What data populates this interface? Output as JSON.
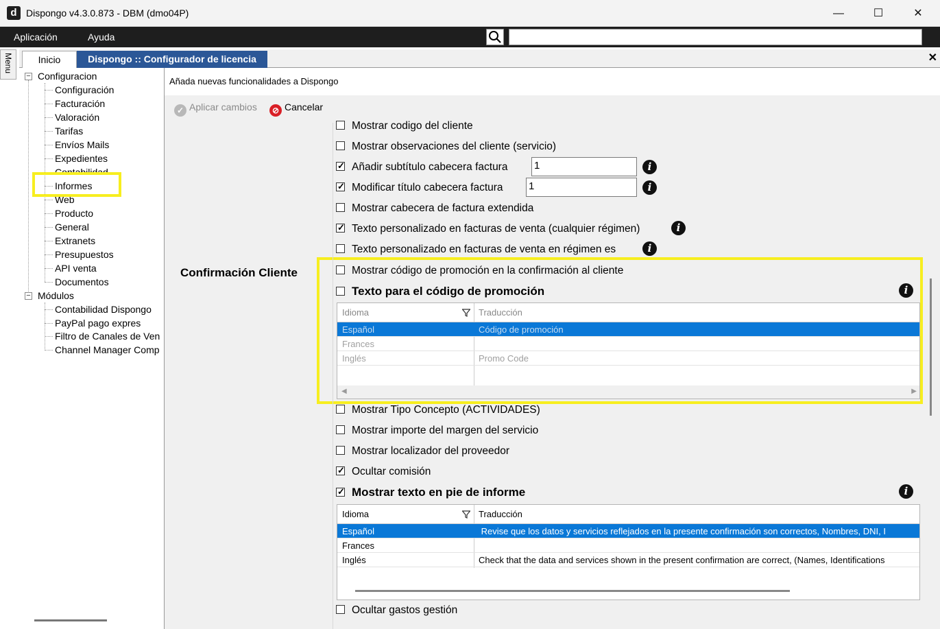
{
  "window": {
    "logo_letter": "d",
    "title": "Dispongo v4.3.0.873 - DBM (dmo04P)",
    "minimize_glyph": "—",
    "maximize_glyph": "☐",
    "close_glyph": "✕"
  },
  "menubar": {
    "items": [
      "Aplicación",
      "Ayuda"
    ],
    "search_value": ""
  },
  "side_tab": {
    "label": "Menu"
  },
  "tabs": {
    "items": [
      "Inicio",
      "Dispongo :: Configurador de licencia"
    ],
    "active_index": 1,
    "close_glyph": "✕"
  },
  "tree": {
    "groups": [
      {
        "label": "Configuracion",
        "toggle": "−",
        "children": [
          "Configuración",
          "Facturación",
          "Valoración",
          "Tarifas",
          "Envíos Mails",
          "Expedientes",
          "Contabilidad",
          "Informes",
          "Web",
          "Producto",
          "General",
          "Extranets",
          "Presupuestos",
          "API venta",
          "Documentos"
        ]
      },
      {
        "label": "Módulos",
        "toggle": "−",
        "children": [
          "Contabilidad Dispongo",
          "PayPal pago expres",
          "Filtro de Canales de Ven",
          "Channel Manager Comp"
        ]
      }
    ],
    "highlighted_item": "Informes"
  },
  "content": {
    "subtitle": "Añada nuevas funcionalidades a Dispongo",
    "toolbar": {
      "apply_label": "Aplicar cambios",
      "cancel_label": "Cancelar"
    },
    "section_label": "Confirmación Cliente",
    "options_top": [
      {
        "label": "Mostrar codigo del cliente",
        "checked": false
      },
      {
        "label": "Mostrar observaciones del cliente (servicio)",
        "checked": false
      },
      {
        "label": "Añadir subtítulo cabecera factura",
        "checked": true,
        "field_value": "1",
        "info": true
      },
      {
        "label": "Modificar título cabecera factura",
        "checked": true,
        "field_value": "1",
        "info": true
      },
      {
        "label": "Mostrar cabecera de factura extendida",
        "checked": false
      },
      {
        "label": "Texto personalizado en facturas de venta (cualquier régimen)",
        "checked": false,
        "info": true
      },
      {
        "label": "Texto personalizado en facturas de venta en régimen es",
        "checked": false,
        "info": true
      }
    ],
    "promo_option": {
      "label": "Mostrar código de promoción en la confirmación al cliente",
      "checked": false
    },
    "promo_text_option": {
      "label": "Texto para el código de promoción",
      "checked": false,
      "info": true
    },
    "promo_grid": {
      "columns": [
        "Idioma",
        "Traducción"
      ],
      "rows": [
        [
          "Español",
          "Código de promoción"
        ],
        [
          "Frances",
          ""
        ],
        [
          "Inglés",
          "Promo Code"
        ]
      ],
      "selected_row": 0,
      "enabled": false,
      "scroll_left_glyph": "◀",
      "scroll_right_glyph": "▶"
    },
    "options_mid": [
      {
        "label": "Mostrar Tipo Concepto (ACTIVIDADES)",
        "checked": false
      },
      {
        "label": "Mostrar importe del margen del servicio",
        "checked": false
      },
      {
        "label": "Mostrar localizador del proveedor",
        "checked": false
      },
      {
        "label": "Ocultar comisión",
        "checked": true
      }
    ],
    "footer_option": {
      "label": "Mostrar texto en pie de informe",
      "checked": true,
      "info": true
    },
    "footer_grid": {
      "columns": [
        "Idioma",
        "Traducción"
      ],
      "rows": [
        [
          "Español",
          " Revise que los datos y servicios reflejados en la presente confirmación son correctos, Nombres, DNI, I"
        ],
        [
          "Frances",
          ""
        ],
        [
          "Inglés",
          "Check that the data and services shown in the present confirmation are correct, (Names, Identifications"
        ]
      ],
      "selected_row": 0,
      "enabled": true
    },
    "options_bottom": [
      {
        "label": "Ocultar gastos gestión",
        "checked": false
      }
    ]
  },
  "colors": {
    "active_tab": "#2b5797",
    "selection": "#0a78d7",
    "highlight": "#f7ee1f",
    "menubar": "#1e1e1e"
  }
}
